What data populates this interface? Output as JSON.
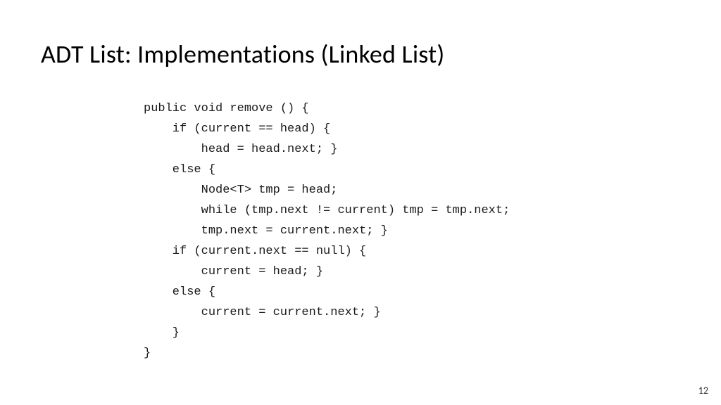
{
  "title": "ADT List: Implementations (Linked List)",
  "code": "public void remove () {\n    if (current == head) {\n        head = head.next; }\n    else {\n        Node<T> tmp = head;\n        while (tmp.next != current) tmp = tmp.next;\n        tmp.next = current.next; }\n    if (current.next == null) {\n        current = head; }\n    else {\n        current = current.next; }\n    }\n}",
  "pageNumber": "12"
}
